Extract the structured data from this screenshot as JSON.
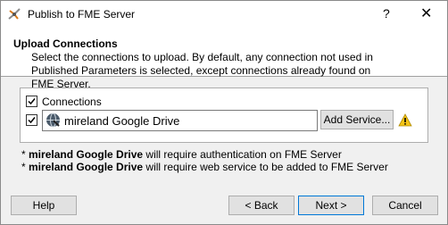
{
  "window": {
    "title": "Publish to FME Server",
    "help_glyph": "?",
    "close_glyph": "✕"
  },
  "header": {
    "title": "Upload Connections",
    "description": "Select the connections to upload. By default, any connection not used in Published Parameters is selected, except connections already found on FME Server."
  },
  "connections": {
    "group_label": "Connections",
    "group_checked": true,
    "items": [
      {
        "name": "mireland Google Drive",
        "checked": true,
        "icon": "google-drive-globe-icon"
      }
    ],
    "add_service_label": "Add Service...",
    "warning_icon": "warning-icon"
  },
  "notes": [
    {
      "bullet": "*",
      "name": "mireland Google Drive",
      "text": " will require authentication on FME Server"
    },
    {
      "bullet": "*",
      "name": "mireland Google Drive",
      "text": " will require web service to be added to FME Server"
    }
  ],
  "buttons": {
    "help": "Help",
    "back": "< Back",
    "next": "Next >",
    "cancel": "Cancel"
  },
  "colors": {
    "accent": "#0078d7",
    "warning": "#f5c518"
  }
}
